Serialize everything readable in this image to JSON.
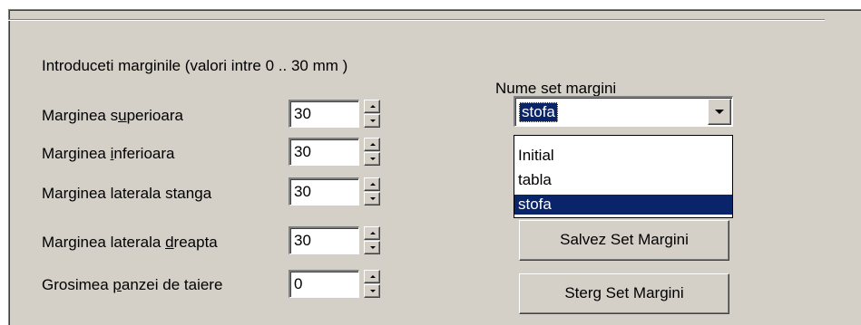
{
  "group": {
    "title": "Introduceti marginile  (valori intre 0 .. 30 mm )"
  },
  "fields": [
    {
      "label_pre": "Marginea s",
      "label_ul": "u",
      "label_post": "perioara",
      "value": "30"
    },
    {
      "label_pre": "Marginea ",
      "label_ul": "i",
      "label_post": "nferioara",
      "value": "30"
    },
    {
      "label_pre": "Marginea laterala stan",
      "label_ul": "g",
      "label_post": "a",
      "value": "30"
    },
    {
      "label_pre": "Marginea laterala ",
      "label_ul": "d",
      "label_post": "reapta",
      "value": "30"
    },
    {
      "label_pre": "Grosimea ",
      "label_ul": "p",
      "label_post": "anzei de taiere",
      "value": "0"
    }
  ],
  "set": {
    "label": "Nume set margini",
    "selected": "stofa",
    "options": [
      "Initial",
      "tabla",
      "stofa"
    ]
  },
  "buttons": {
    "save": "Salvez Set Margini",
    "delete": "Sterg Set Margini"
  },
  "colors": {
    "face": "#d4d0c8",
    "highlight": "#0a246a"
  }
}
